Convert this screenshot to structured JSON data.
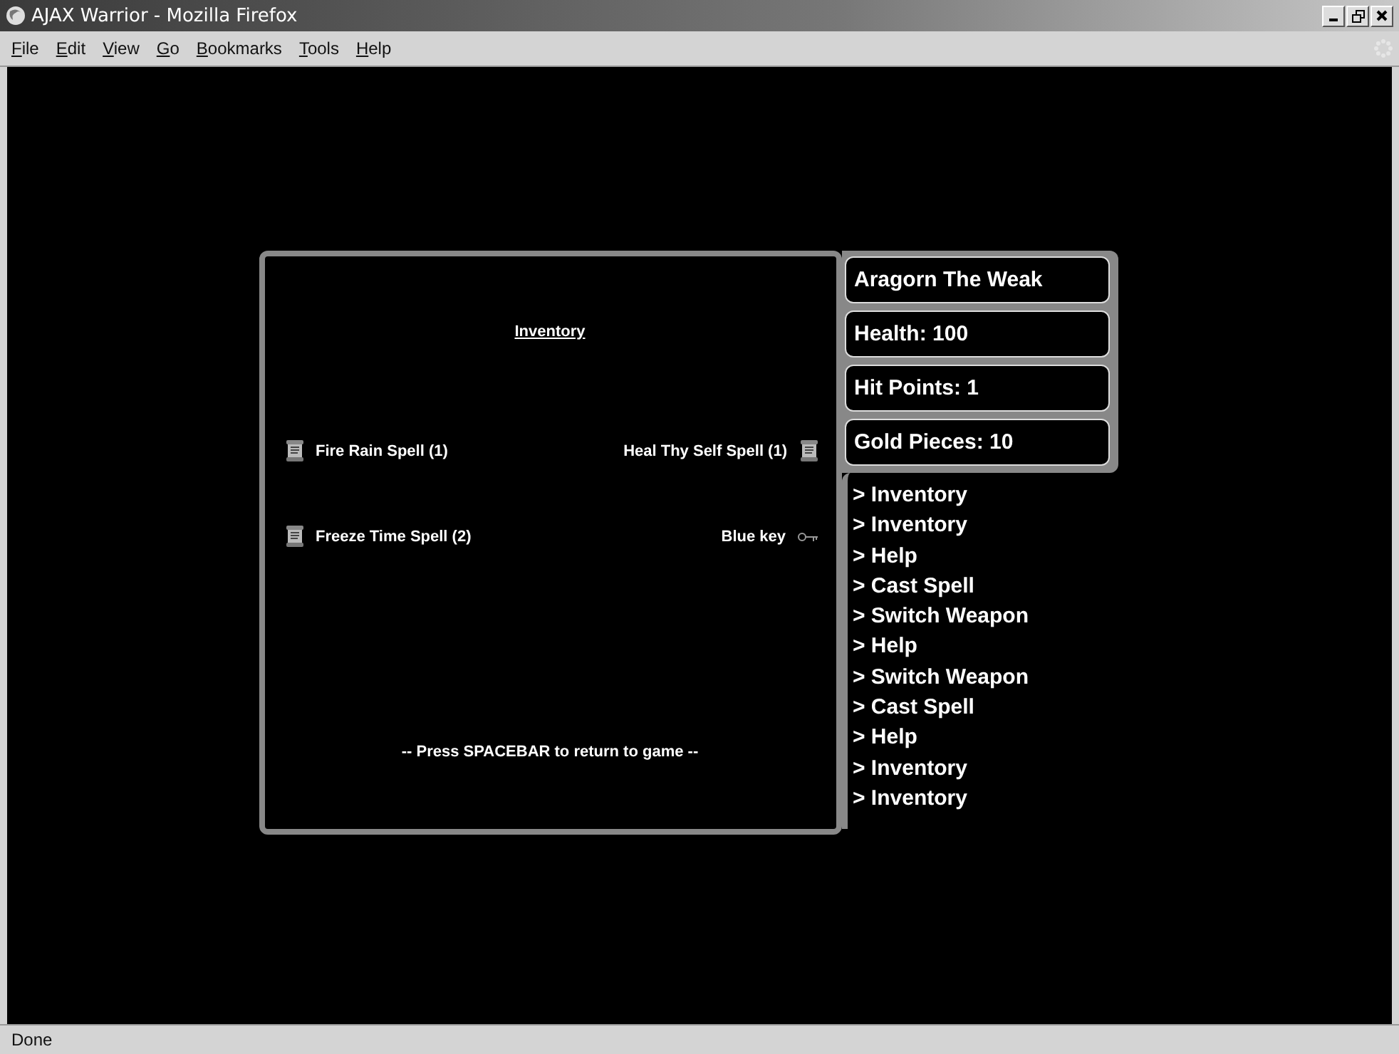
{
  "window": {
    "title": "AJAX Warrior - Mozilla Firefox"
  },
  "menu": [
    "File",
    "Edit",
    "View",
    "Go",
    "Bookmarks",
    "Tools",
    "Help"
  ],
  "inventory": {
    "title": "Inventory",
    "rows": [
      {
        "left": {
          "name": "Fire Rain Spell (1)",
          "kind": "scroll"
        },
        "right": {
          "name": "Heal Thy Self Spell (1)",
          "kind": "scroll"
        }
      },
      {
        "left": {
          "name": "Freeze Time Spell (2)",
          "kind": "scroll"
        },
        "right": {
          "name": "Blue key",
          "kind": "key"
        }
      }
    ],
    "hint": "-- Press SPACEBAR to return to game --"
  },
  "stats": [
    "Aragorn The Weak",
    "Health: 100",
    "Hit Points: 1",
    "Gold Pieces: 10"
  ],
  "log": [
    "> Inventory",
    "> Inventory",
    "> Help",
    "> Cast Spell",
    "> Switch Weapon",
    "> Help",
    "> Switch Weapon",
    "> Cast Spell",
    "> Help",
    "> Inventory",
    "> Inventory"
  ],
  "status_bar": "Done"
}
